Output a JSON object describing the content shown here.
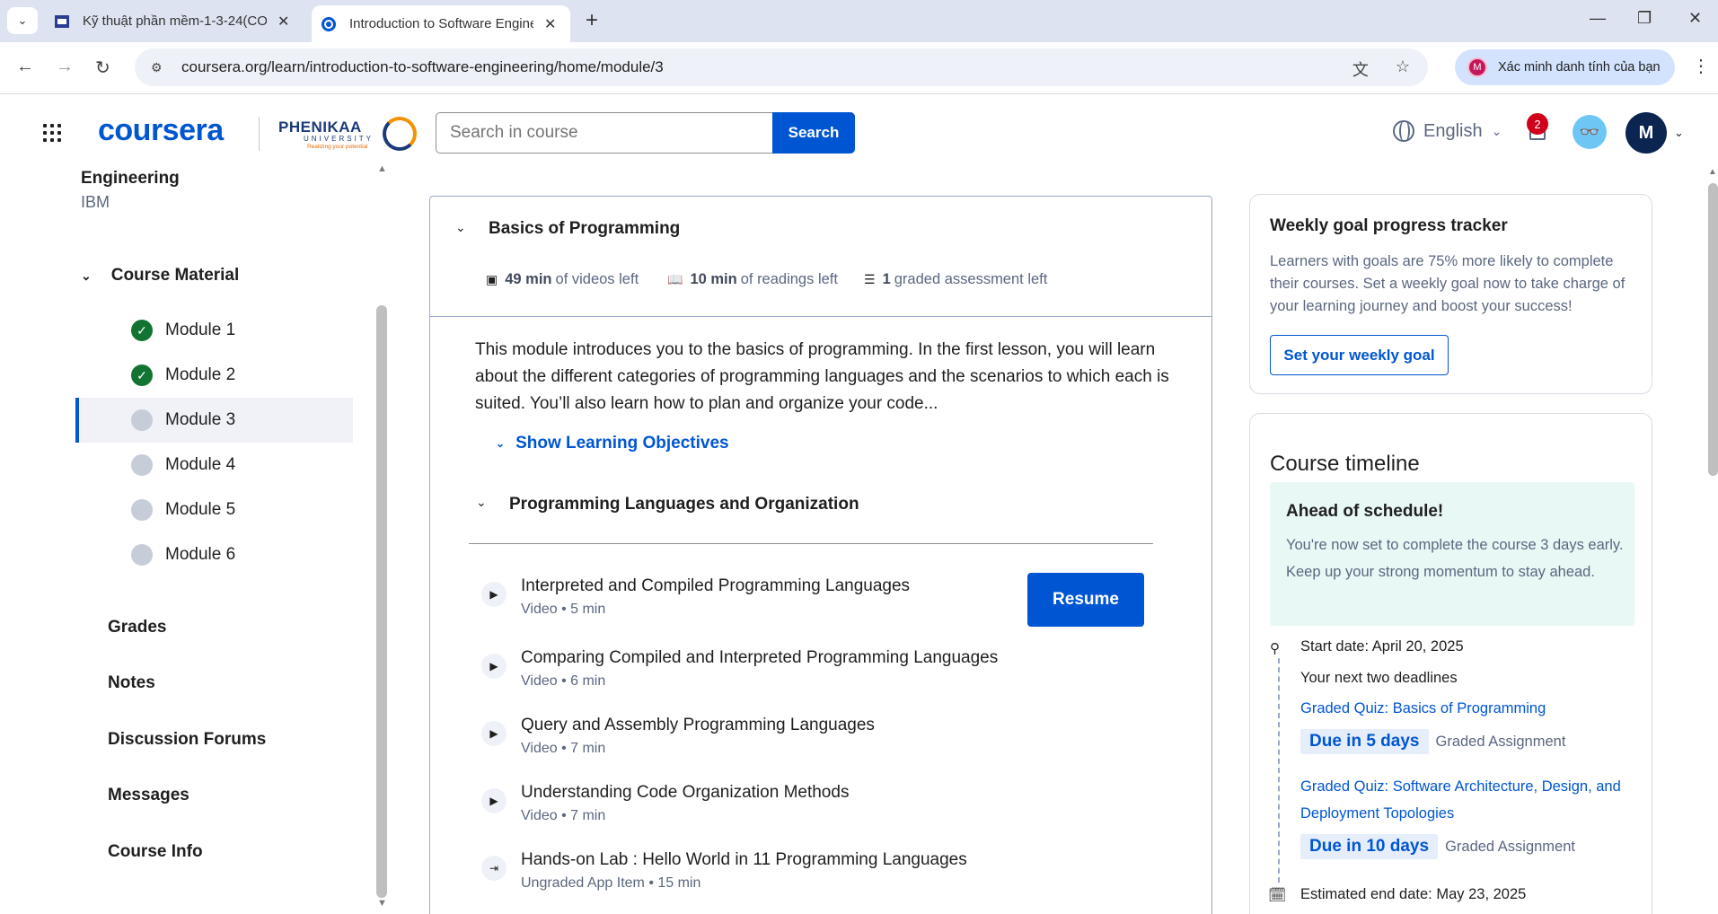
{
  "browser": {
    "tabs": [
      {
        "title": "Kỹ thuật phần mềm-1-3-24(CO",
        "active": false
      },
      {
        "title": "Introduction to Software Engine",
        "active": true
      }
    ],
    "url": "coursera.org/learn/introduction-to-software-engineering/home/module/3",
    "profile_label": "Xác minh danh tính của bạn",
    "profile_initial": "M"
  },
  "header": {
    "logo": "coursera",
    "partner_name": "PHENIKAA",
    "partner_sub": "UNIVERSITY",
    "partner_tagline": "Realizing your potential",
    "search_placeholder": "Search in course",
    "search_button": "Search",
    "language": "English",
    "notification_count": "2",
    "avatar_initial": "M"
  },
  "sidebar": {
    "course_name": "Engineering",
    "course_org": "IBM",
    "course_material_label": "Course Material",
    "modules": [
      {
        "label": "Module 1",
        "status": "done"
      },
      {
        "label": "Module 2",
        "status": "done"
      },
      {
        "label": "Module 3",
        "status": "current"
      },
      {
        "label": "Module 4",
        "status": "todo"
      },
      {
        "label": "Module 5",
        "status": "todo"
      },
      {
        "label": "Module 6",
        "status": "todo"
      }
    ],
    "links": [
      "Grades",
      "Notes",
      "Discussion Forums",
      "Messages",
      "Course Info"
    ]
  },
  "module": {
    "title": "Basics of Programming",
    "videos_left_value": "49 min",
    "videos_left_label": "of videos left",
    "readings_left_value": "10 min",
    "readings_left_label": "of readings left",
    "graded_left_value": "1",
    "graded_left_label": "graded assessment left",
    "description": "This module introduces you to the basics of programming. In the first lesson, you will learn about the different categories of programming languages and the scenarios to which each is suited. You’ll also learn how to plan and organize your code...",
    "show_objectives": "Show Learning Objectives",
    "lesson_title": "Programming Languages and Organization",
    "resume_label": "Resume",
    "items": [
      {
        "title": "Interpreted and Compiled Programming Languages",
        "meta": "Video • 5 min",
        "icon": "play-icon"
      },
      {
        "title": "Comparing Compiled and Interpreted Programming Languages",
        "meta": "Video • 6 min",
        "icon": "play-icon"
      },
      {
        "title": "Query and Assembly Programming Languages",
        "meta": "Video • 7 min",
        "icon": "play-icon"
      },
      {
        "title": "Understanding Code Organization Methods",
        "meta": "Video • 7 min",
        "icon": "play-icon"
      },
      {
        "title": "Hands-on Lab : Hello World in 11 Programming Languages",
        "meta": "Ungraded App Item • 15 min",
        "icon": "lab-icon"
      }
    ]
  },
  "goal": {
    "title": "Weekly goal progress tracker",
    "text": "Learners with goals are 75% more likely to complete their courses. Set a weekly goal now to take charge of your learning journey and boost your success!",
    "button": "Set your weekly goal"
  },
  "timeline": {
    "title": "Course timeline",
    "ahead_title": "Ahead of schedule!",
    "ahead_text": "You're now set to complete the course 3 days early. Keep up your strong momentum to stay ahead.",
    "start_date": "Start date: April 20, 2025",
    "next_deadlines": "Your next two deadlines",
    "deadline1_title": "Graded Quiz: Basics of Programming",
    "deadline1_due": "Due in 5 days",
    "deadline1_kind": "Graded Assignment",
    "deadline2_title": "Graded Quiz: Software Architecture, Design, and Deployment Topologies",
    "deadline2_due": "Due in 10 days",
    "deadline2_kind": "Graded Assignment",
    "end_date": "Estimated end date: May 23, 2025"
  },
  "colors": {
    "brand": "#0056d2",
    "done": "#137333",
    "ahead_bg": "#e8f8f5"
  }
}
